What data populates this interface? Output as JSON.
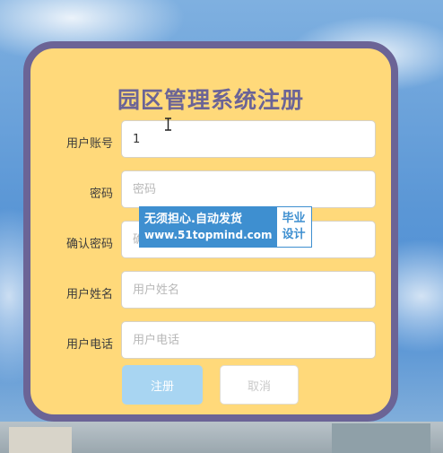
{
  "form": {
    "title": "园区管理系统注册",
    "fields": [
      {
        "label": "用户账号",
        "value": "1",
        "placeholder": ""
      },
      {
        "label": "密码",
        "value": "",
        "placeholder": "密码"
      },
      {
        "label": "确认密码",
        "value": "",
        "placeholder": "确认密码"
      },
      {
        "label": "用户姓名",
        "value": "",
        "placeholder": "用户姓名"
      },
      {
        "label": "用户电话",
        "value": "",
        "placeholder": "用户电话"
      }
    ],
    "register_label": "注册",
    "cancel_label": "取消"
  },
  "watermark": {
    "line1": "无须担心.自动发货",
    "line2": "www.51topmind.com",
    "side_line1": "毕业",
    "side_line2": "设计"
  },
  "colors": {
    "card_bg": "#ffd97a",
    "card_border": "#6b6496",
    "title": "#6b6496",
    "register_button": "#a8d5f2",
    "watermark_blue": "#3e8fd0"
  }
}
